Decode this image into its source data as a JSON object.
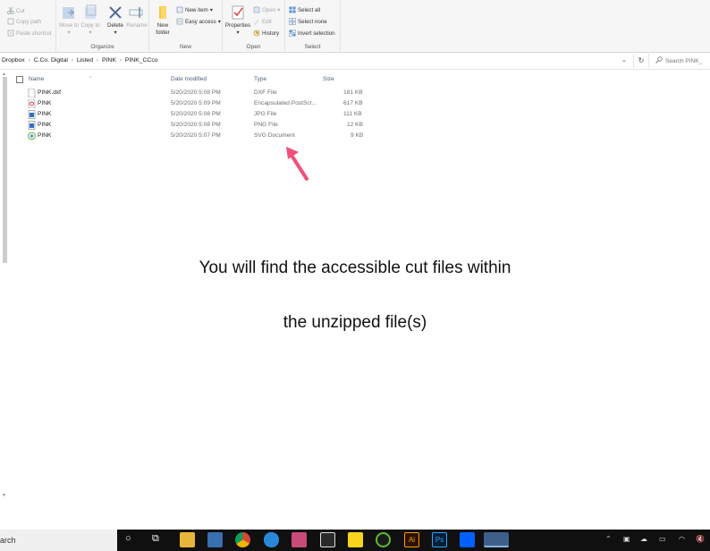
{
  "ribbon": {
    "clipboard": {
      "cut": "Cut",
      "copy_path": "Copy path",
      "paste_shortcut": "Paste shortcut"
    },
    "organize": {
      "move_to": "Move to",
      "copy_to": "Copy to",
      "delete": "Delete",
      "rename": "Rename",
      "label": "Organize"
    },
    "new": {
      "new_folder": "New folder",
      "new_item": "New item",
      "easy_access": "Easy access",
      "label": "New"
    },
    "open": {
      "properties": "Properties",
      "open": "Open",
      "edit": "Edit",
      "history": "History",
      "label": "Open"
    },
    "select": {
      "select_all": "Select all",
      "select_none": "Select none",
      "invert_selection": "Invert selection",
      "label": "Select"
    }
  },
  "breadcrumb": [
    "Dropbox",
    "C.Co. Digital",
    "Listed",
    "PINK",
    "PINK_CCco"
  ],
  "search": {
    "placeholder": "Search PINK_"
  },
  "columns": {
    "name": "Name",
    "date": "Date modified",
    "type": "Type",
    "size": "Size"
  },
  "files": [
    {
      "name": "PINK.dxf",
      "date": "5/20/2020 5:08 PM",
      "type": "DXF File",
      "size": "181 KB",
      "icon": "dxf-file-icon"
    },
    {
      "name": "PINK",
      "date": "5/20/2020 5:09 PM",
      "type": "Encapsulated PostScr...",
      "size": "617 KB",
      "icon": "eps-file-icon"
    },
    {
      "name": "PINK",
      "date": "5/20/2020 5:08 PM",
      "type": "JPG File",
      "size": "111 KB",
      "icon": "jpg-file-icon"
    },
    {
      "name": "PINK",
      "date": "5/20/2020 5:08 PM",
      "type": "PNG File",
      "size": "12 KB",
      "icon": "png-file-icon"
    },
    {
      "name": "PINK",
      "date": "5/20/2020 5:07 PM",
      "type": "SVG Document",
      "size": "9 KB",
      "icon": "svg-file-icon"
    }
  ],
  "message": {
    "line1": "You will find the accessible cut files within",
    "line2": "the unzipped file(s)"
  },
  "taskbar": {
    "search_text": "arch"
  },
  "colors": {
    "arrow": "#f0507a",
    "taskbar": "#101010",
    "ribbon": "#f6f6f6"
  }
}
